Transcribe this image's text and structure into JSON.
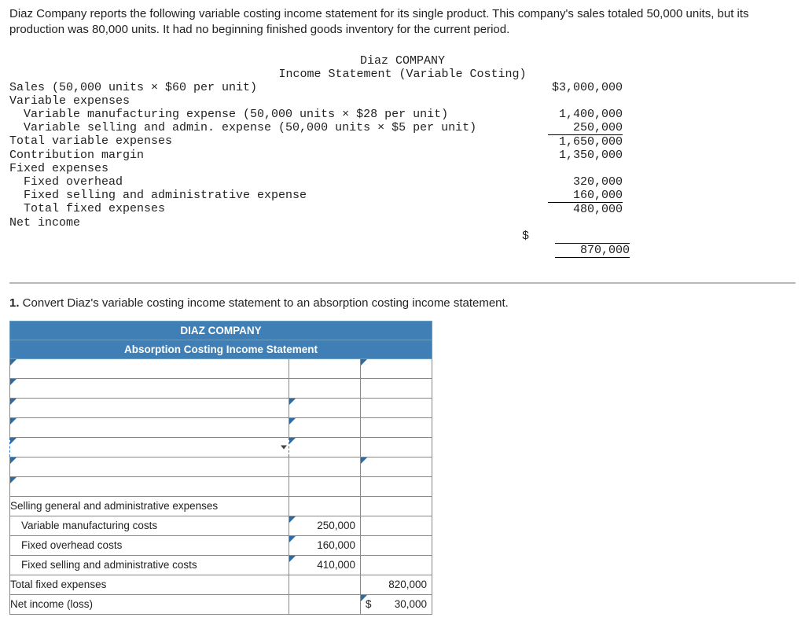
{
  "intro": "Diaz Company reports the following variable costing income statement for its single product. This company's sales totaled 50,000 units, but its production was 80,000 units. It had no beginning finished goods inventory for the current period.",
  "vc": {
    "company": "Diaz COMPANY",
    "title": "Income Statement (Variable Costing)",
    "rows": {
      "sales_label": "Sales (50,000 units × $60 per unit)",
      "sales_amt": "$3,000,000",
      "varexp_label": "Variable expenses",
      "vman_label": "  Variable manufacturing expense (50,000 units × $28 per unit)",
      "vman_amt": "1,400,000",
      "vsell_label": "  Variable selling and admin. expense (50,000 units × $5 per unit)",
      "vsell_amt": "250,000",
      "tvar_label": "Total variable expenses",
      "tvar_amt": "1,650,000",
      "cm_label": "Contribution margin",
      "cm_amt": "1,350,000",
      "fexp_label": "Fixed expenses",
      "foh_label": "  Fixed overhead",
      "foh_amt": "320,000",
      "fsga_label": "  Fixed selling and administrative expense",
      "fsga_amt": "160,000",
      "tfix_label": "  Total fixed expenses",
      "tfix_amt": "480,000",
      "ni_label": "Net income",
      "ni_cur": "$",
      "ni_amt": "870,000"
    }
  },
  "q1_num": "1.",
  "q1_text": " Convert Diaz's variable costing income statement to an absorption costing income statement.",
  "abs": {
    "company": "DIAZ COMPANY",
    "title": "Absorption Costing Income Statement",
    "rows": {
      "sga": "Selling general and administrative expenses",
      "vman": "Variable manufacturing costs",
      "vman_amt": "250,000",
      "foh": "Fixed overhead costs",
      "foh_amt": "160,000",
      "fsac": "Fixed selling and administrative costs",
      "fsac_amt": "410,000",
      "tfe": "Total fixed expenses",
      "tfe_amt": "820,000",
      "ni": "Net income (loss)",
      "ni_cur": "$",
      "ni_amt": "30,000"
    }
  }
}
